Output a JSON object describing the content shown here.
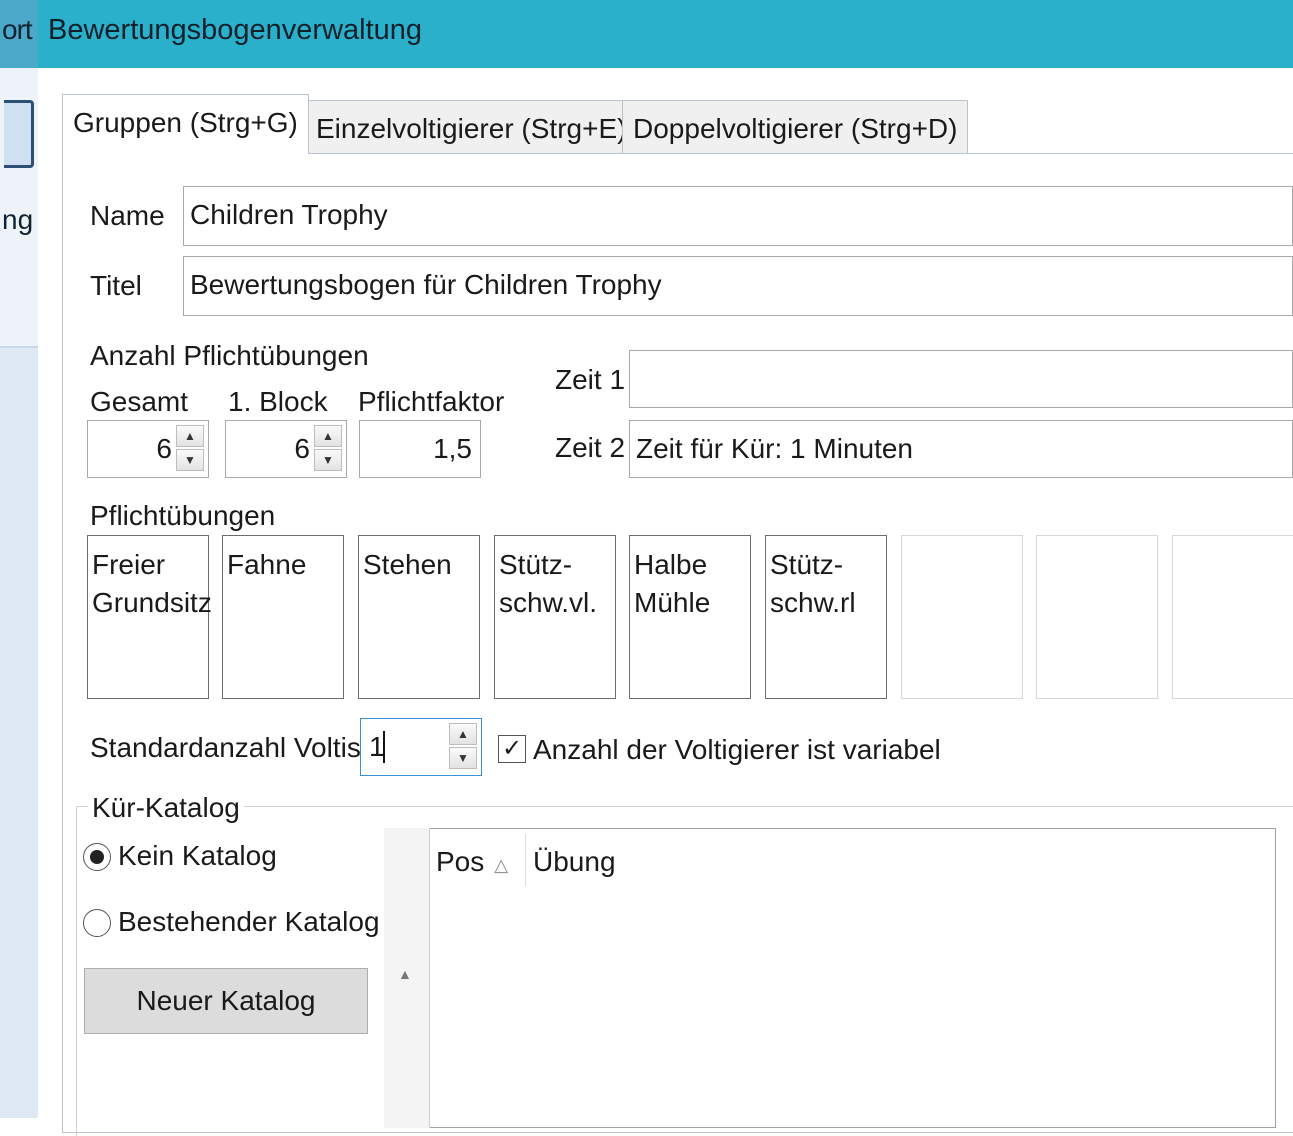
{
  "background": {
    "title_fragment": "ort",
    "label_fragment": "ng"
  },
  "dialog": {
    "title": "Bewertungsbogenverwaltung"
  },
  "tabs": [
    {
      "label": "Gruppen (Strg+G)",
      "active": true
    },
    {
      "label": "Einzelvoltigierer (Strg+E)",
      "active": false
    },
    {
      "label": "Doppelvoltigierer (Strg+D)",
      "active": false
    }
  ],
  "form": {
    "name_label": "Name",
    "name_value": "Children Trophy",
    "titel_label": "Titel",
    "titel_value": "Bewertungsbogen für Children Trophy",
    "anzahl_label": "Anzahl Pflichtübungen",
    "gesamt_label": "Gesamt",
    "gesamt_value": "6",
    "block_label": "1. Block",
    "block_value": "6",
    "faktor_label": "Pflichtfaktor",
    "faktor_value": "1,5",
    "zeit1_label": "Zeit 1",
    "zeit1_value": "",
    "zeit2_label": "Zeit 2",
    "zeit2_value": "Zeit für Kür: 1 Minuten"
  },
  "pflicht": {
    "label": "Pflichtübungen",
    "exercises": [
      {
        "line1": "Freier",
        "line2": "Grundsitz"
      },
      {
        "line1": "Fahne",
        "line2": ""
      },
      {
        "line1": "Stehen",
        "line2": ""
      },
      {
        "line1": "Stütz-",
        "line2": "schw.vl."
      },
      {
        "line1": "Halbe",
        "line2": "Mühle"
      },
      {
        "line1": "Stütz-",
        "line2": "schw.rl"
      },
      {
        "line1": "",
        "line2": ""
      },
      {
        "line1": "",
        "line2": ""
      },
      {
        "line1": "",
        "line2": ""
      }
    ]
  },
  "voltis": {
    "label": "Standardanzahl Voltis",
    "value": "1",
    "variable_checked": true,
    "variable_label": "Anzahl der Voltigierer ist variabel"
  },
  "kuer": {
    "group_title": "Kür-Katalog",
    "radio_none_label": "Kein Katalog",
    "radio_existing_label": "Bestehender Katalog",
    "selected": "none",
    "new_button_label": "Neuer Katalog",
    "grid_headers": [
      "Pos",
      "Übung"
    ],
    "sort_indicator": "△",
    "scroll_arrow": "▲"
  },
  "colors": {
    "titlebar": "#2bb0cc",
    "background_window": "#4aa9c9"
  }
}
